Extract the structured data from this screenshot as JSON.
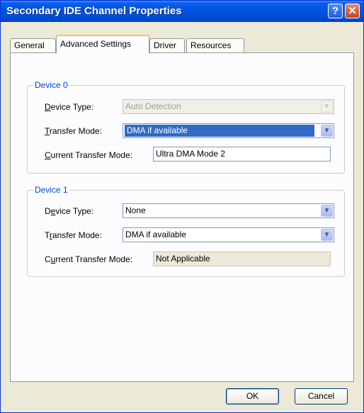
{
  "window": {
    "title": "Secondary IDE Channel Properties",
    "help_glyph": "?",
    "close_glyph": "✕"
  },
  "tabs": [
    {
      "label": "General",
      "active": false
    },
    {
      "label": "Advanced Settings",
      "active": true
    },
    {
      "label": "Driver",
      "active": false
    },
    {
      "label": "Resources",
      "active": false
    }
  ],
  "device0": {
    "title": "Device 0",
    "device_type_label_ul": "D",
    "device_type_label_rest": "evice Type:",
    "device_type_value": "Auto Detection",
    "transfer_mode_label_ul": "T",
    "transfer_mode_label_rest": "ransfer Mode:",
    "transfer_mode_value": "DMA if available",
    "current_label_ul": "C",
    "current_label_rest": "urrent Transfer Mode:",
    "current_value": "Ultra DMA Mode 2"
  },
  "device1": {
    "title": "Device 1",
    "device_type_label_ul": "e",
    "device_type_label_pre": "D",
    "device_type_label_rest": "vice Type:",
    "device_type_value": "None",
    "transfer_mode_label_pre": "T",
    "transfer_mode_label_ul": "r",
    "transfer_mode_label_rest": "ansfer Mode:",
    "transfer_mode_value": "DMA if available",
    "current_label_pre": "C",
    "current_label_ul": "u",
    "current_label_rest": "rrent Transfer Mode:",
    "current_value": "Not Applicable"
  },
  "dropdown_arrow": "▼",
  "buttons": {
    "ok": "OK",
    "cancel": "Cancel"
  },
  "colors": {
    "title_bar": "#0054e3",
    "selection": "#316ac5",
    "group_title": "#0046d5",
    "active_tab_accent": "#ffc83c"
  }
}
